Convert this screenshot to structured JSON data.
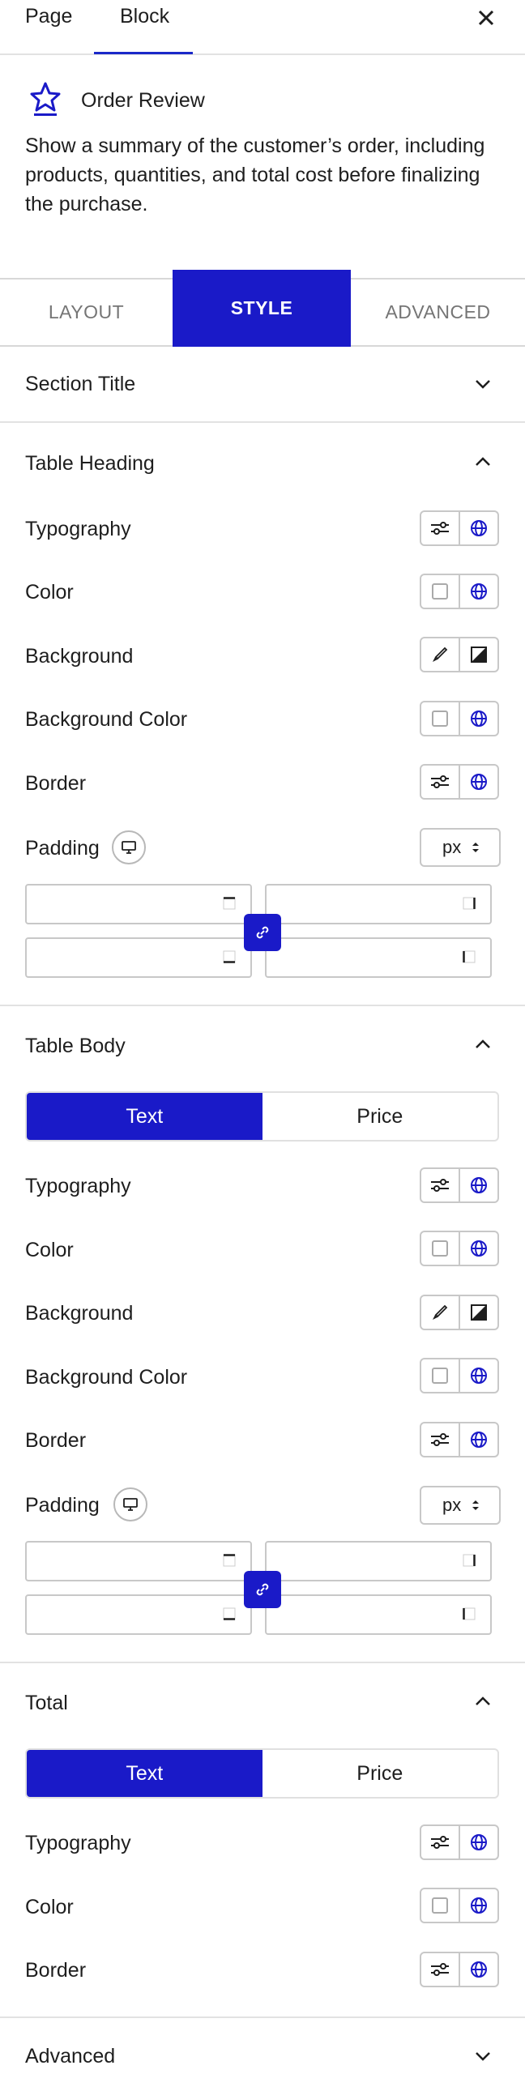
{
  "top_tabs": {
    "page": "Page",
    "block": "Block"
  },
  "block": {
    "title": "Order Review",
    "description": "Show a summary of the customer’s order, including products, quantities, and total cost before finalizing the purchase."
  },
  "settings_tabs": {
    "layout": "LAYOUT",
    "style": "STYLE",
    "advanced": "ADVANCED"
  },
  "sections": {
    "section_title": "Section Title",
    "table_heading": {
      "title": "Table Heading",
      "typography": "Typography",
      "color": "Color",
      "background": "Background",
      "background_color": "Background Color",
      "border": "Border",
      "padding": "Padding",
      "unit": "px"
    },
    "table_body": {
      "title": "Table Body",
      "seg_text": "Text",
      "seg_price": "Price",
      "typography": "Typography",
      "color": "Color",
      "background": "Background",
      "background_color": "Background Color",
      "border": "Border",
      "padding": "Padding",
      "unit": "px"
    },
    "total": {
      "title": "Total",
      "seg_text": "Text",
      "seg_price": "Price",
      "typography": "Typography",
      "color": "Color",
      "border": "Border"
    },
    "advanced": "Advanced"
  },
  "accent": "#1a1ac8"
}
